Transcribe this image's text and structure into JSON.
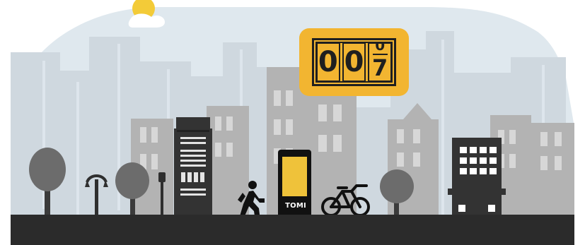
{
  "scene": {
    "colors": {
      "sky": "#dfe8ee",
      "road": "#2b2b2b",
      "building_light": "#cfd8df",
      "building_mid": "#b3b3b3",
      "tree_dark": "#6c6c6c",
      "kiosk_screen": "#efc23a",
      "sun": "#f3cb38",
      "counter_bg": "#f2b531"
    },
    "icons": {
      "sun": "sun-icon",
      "walker": "walking-person-icon",
      "bicycle": "bicycle-icon",
      "street_lamp": "street-lamp-icon"
    }
  },
  "counter": {
    "digit_1": "0",
    "digit_2": "0",
    "digit_3_top": "0",
    "digit_3_bottom": "7"
  },
  "kiosk": {
    "label": "TOMI"
  }
}
